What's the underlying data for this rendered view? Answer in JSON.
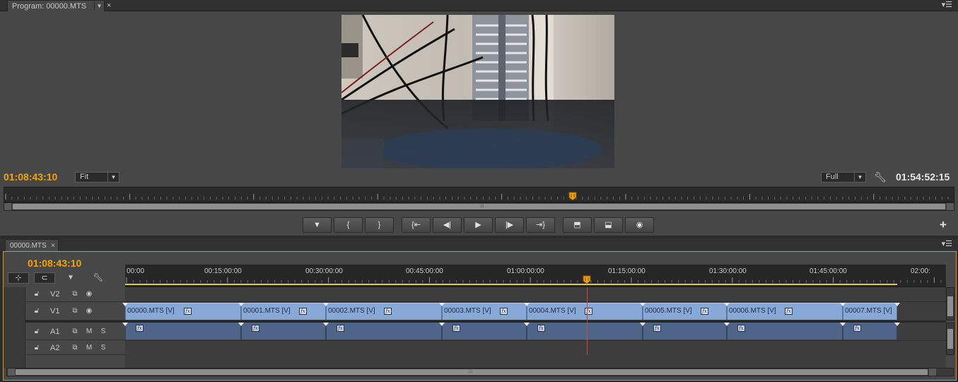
{
  "program": {
    "tab_label": "Program: 00000.MTS",
    "current_timecode": "01:08:43:10",
    "fit_label": "Fit",
    "quality_label": "Full",
    "duration_timecode": "01:54:52:15",
    "scroll_grip": "⁞⁞⁞",
    "transport_buttons": [
      {
        "name": "add-marker-button",
        "icon": "marker-icon",
        "glyph": "▼"
      },
      {
        "name": "mark-in-button",
        "icon": "mark-in-icon",
        "glyph": "{"
      },
      {
        "name": "mark-out-button",
        "icon": "mark-out-icon",
        "glyph": "}"
      },
      {
        "name": "go-to-in-button",
        "icon": "go-to-in-icon",
        "glyph": "{⇤"
      },
      {
        "name": "step-back-button",
        "icon": "step-back-icon",
        "glyph": "◀|"
      },
      {
        "name": "play-button",
        "icon": "play-icon",
        "glyph": "▶"
      },
      {
        "name": "step-forward-button",
        "icon": "step-forward-icon",
        "glyph": "|▶"
      },
      {
        "name": "go-to-out-button",
        "icon": "go-to-out-icon",
        "glyph": "⇥}"
      },
      {
        "name": "lift-button",
        "icon": "lift-icon",
        "glyph": "⬒"
      },
      {
        "name": "extract-button",
        "icon": "extract-icon",
        "glyph": "⬓"
      },
      {
        "name": "export-frame-button",
        "icon": "camera-icon",
        "glyph": "◉"
      }
    ],
    "add_button_label": "+"
  },
  "timeline": {
    "tab_label": "00000.MTS",
    "tab_close": "×",
    "current_timecode": "01:08:43:10",
    "ruler_labels": [
      "00:00",
      "00:15:00:00",
      "00:30:00:00",
      "00:45:00:00",
      "01:00:00:00",
      "01:15:00:00",
      "01:30:00:00",
      "01:45:00:00",
      "02:00:"
    ],
    "tracks": {
      "video": [
        {
          "label": "V2",
          "lock": "lock-icon",
          "toggle": "film-icon",
          "eye": "eye-icon"
        },
        {
          "label": "V1",
          "lock": "lock-icon",
          "toggle": "film-icon",
          "eye": "eye-icon"
        }
      ],
      "audio": [
        {
          "label": "A1",
          "mute": "M",
          "solo": "S"
        },
        {
          "label": "A2",
          "mute": "M",
          "solo": "S"
        }
      ]
    },
    "clips": [
      "00000.MTS [V]",
      "00001.MTS [V]",
      "00002.MTS [V]",
      "00003.MTS [V]",
      "00004.MTS [V]",
      "00005.MTS [V]",
      "00006.MTS [V]",
      "00007.MTS [V]"
    ],
    "fx_label": "fx",
    "scroll_grip": "⁞⁞⁞",
    "colors": {
      "timecode": "#f2a20f",
      "video_clip": "#88a9d8",
      "audio_clip": "#4e6488",
      "playhead": "#e03c28",
      "panel_focus": "#d69a12"
    }
  },
  "icons": {
    "panel_menu": "panel-menu-icon",
    "wrench": "wrench-icon",
    "snap": "snap-icon",
    "linked": "linked-selection-icon",
    "marker": "marker-icon",
    "settings": "wrench-icon"
  }
}
